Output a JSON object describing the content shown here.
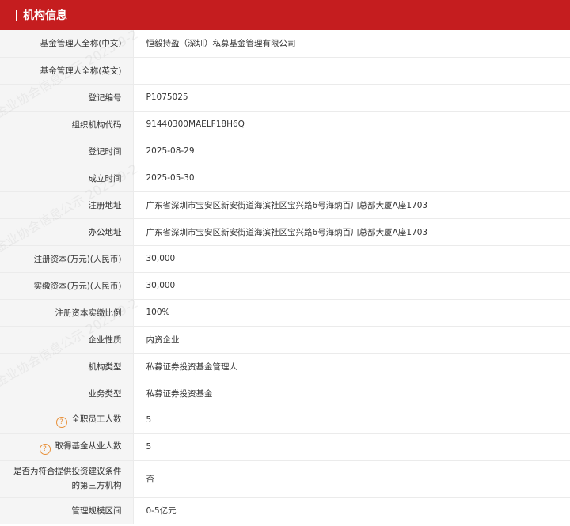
{
  "header": {
    "title": "机构信息"
  },
  "watermark": "金业协会信息公示 2025-9-2",
  "rows": [
    {
      "label": "基金管理人全称(中文)",
      "value": "恒毅持盈（深圳）私募基金管理有限公司"
    },
    {
      "label": "基金管理人全称(英文)",
      "value": ""
    },
    {
      "label": "登记编号",
      "value": "P1075025"
    },
    {
      "label": "组织机构代码",
      "value": "91440300MAELF18H6Q"
    },
    {
      "label": "登记时间",
      "value": "2025-08-29"
    },
    {
      "label": "成立时间",
      "value": "2025-05-30"
    },
    {
      "label": "注册地址",
      "value": "广东省深圳市宝安区新安街道海滨社区宝兴路6号海纳百川总部大厦A座1703"
    },
    {
      "label": "办公地址",
      "value": "广东省深圳市宝安区新安街道海滨社区宝兴路6号海纳百川总部大厦A座1703"
    },
    {
      "label": "注册资本(万元)(人民币)",
      "value": "30,000"
    },
    {
      "label": "实缴资本(万元)(人民币)",
      "value": "30,000"
    },
    {
      "label": "注册资本实缴比例",
      "value": "100%"
    },
    {
      "label": "企业性质",
      "value": "内资企业"
    },
    {
      "label": "机构类型",
      "value": "私募证券投资基金管理人"
    },
    {
      "label": "业务类型",
      "value": "私募证券投资基金"
    },
    {
      "label": "全职员工人数",
      "value": "5",
      "help_icon": "question-icon"
    },
    {
      "label": "取得基金从业人数",
      "value": "5",
      "help_icon": "question-icon"
    },
    {
      "label_line1": "是否为符合提供投资建议条件",
      "label_line2": "的第三方机构",
      "value": "否"
    },
    {
      "label": "管理规模区间",
      "value": "0-5亿元"
    }
  ],
  "colors": {
    "header_bg": "#c51d1f",
    "label_bg": "#f5f5f5",
    "help_icon": "#e8913a"
  }
}
